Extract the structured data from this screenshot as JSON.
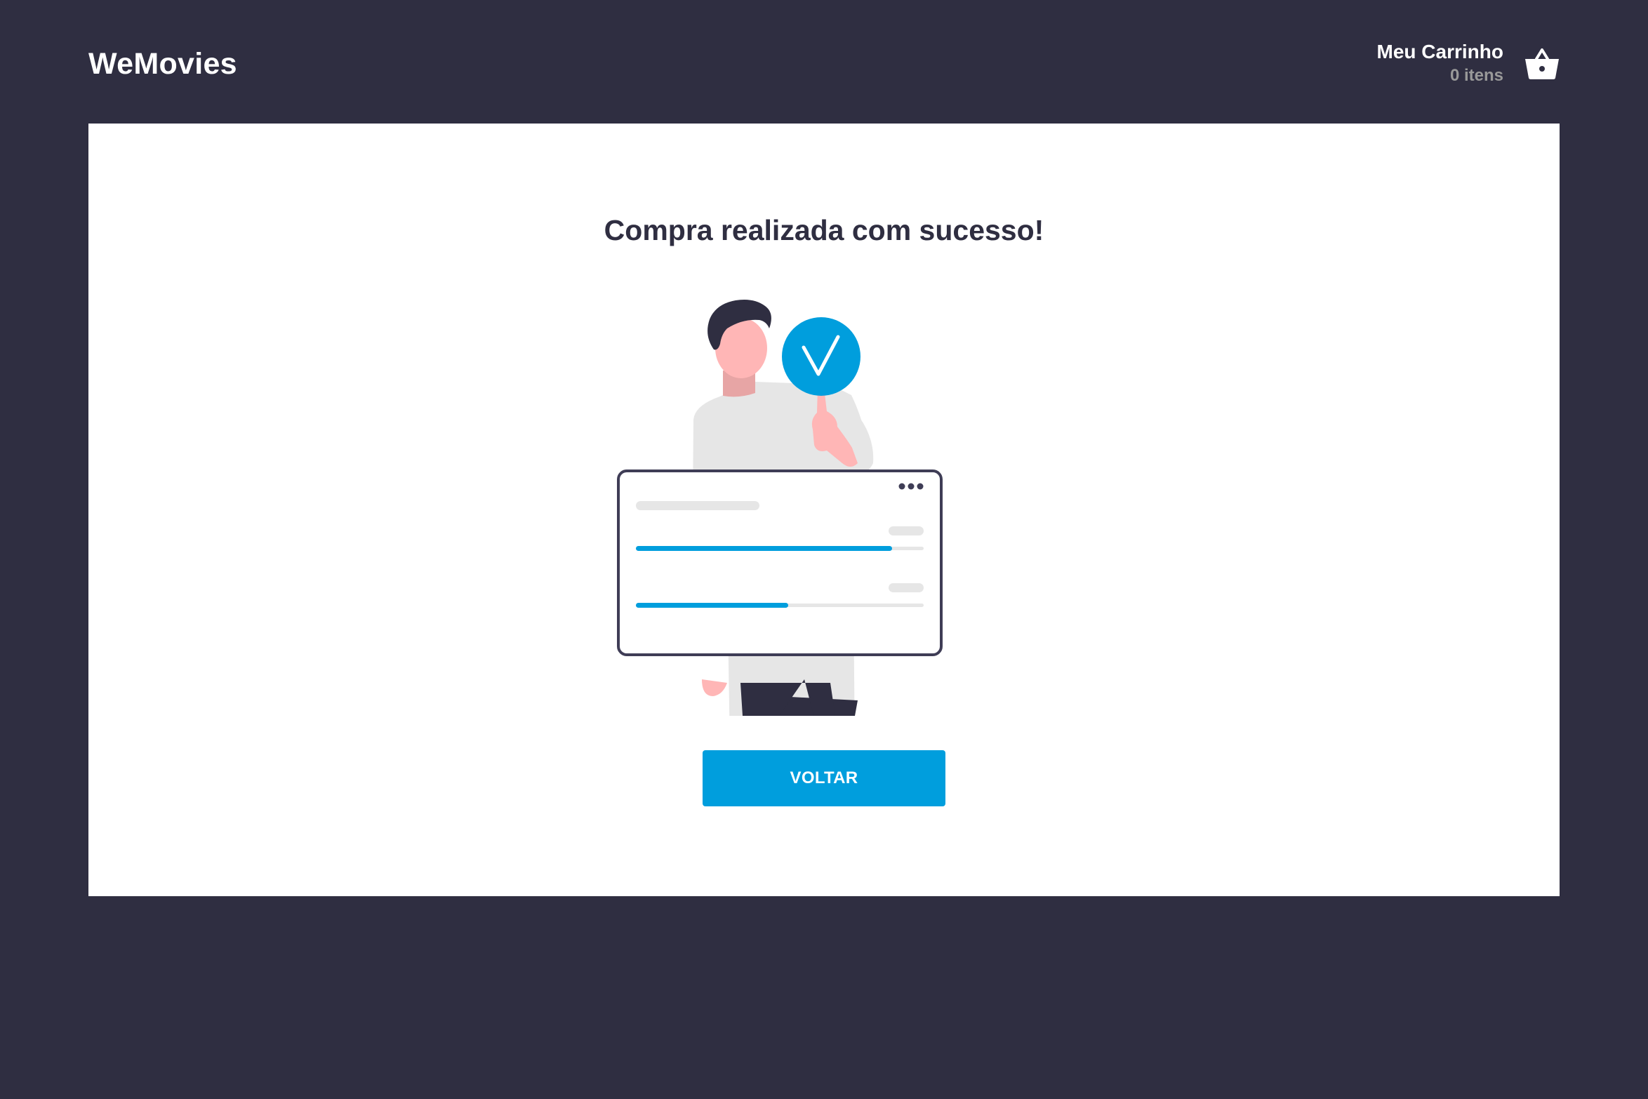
{
  "header": {
    "logo": "WeMovies",
    "cart": {
      "title": "Meu Carrinho",
      "count_label": "0 itens",
      "icon": "basket-icon"
    }
  },
  "main": {
    "title": "Compra realizada com sucesso!",
    "illustration": {
      "icon": "success-check-icon",
      "progress_bars": [
        0.89,
        0.53
      ]
    },
    "button_label": "VOLTAR"
  },
  "colors": {
    "background": "#2F2E41",
    "panel": "#FFFFFF",
    "accent": "#009EDD",
    "muted_text": "#999999"
  }
}
